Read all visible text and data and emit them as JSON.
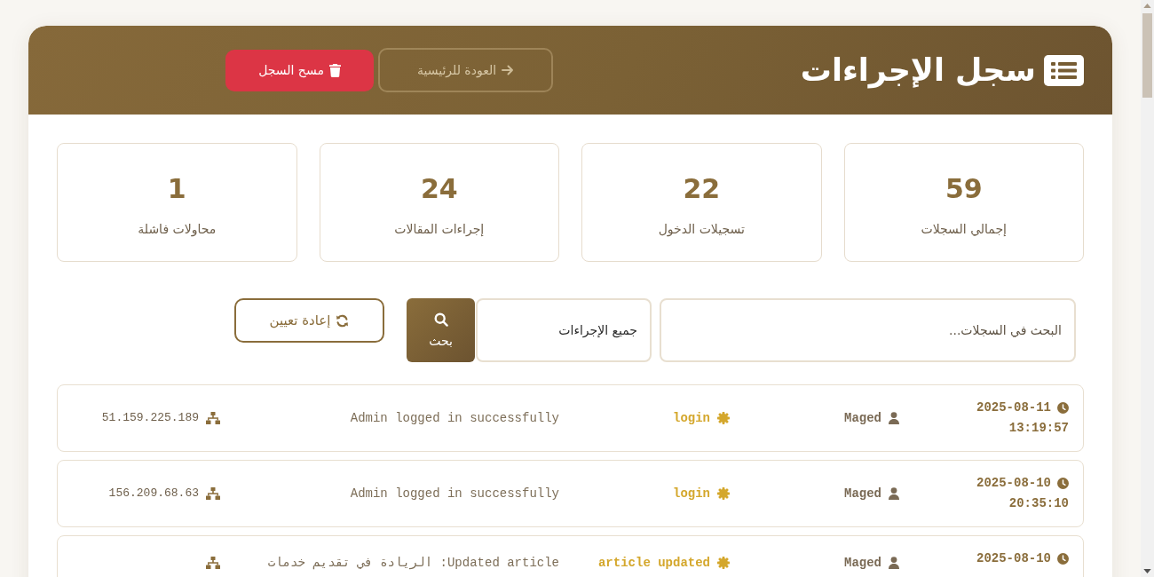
{
  "header": {
    "title": "سجل الإجراءات",
    "buttons": [
      {
        "kind": "back",
        "label": "العودة للرئيسية"
      },
      {
        "kind": "clear",
        "label": "مسح السجل"
      }
    ]
  },
  "stats": [
    {
      "value": "59",
      "label": "إجمالي السجلات"
    },
    {
      "value": "22",
      "label": "تسجيلات الدخول"
    },
    {
      "value": "24",
      "label": "إجراءات المقالات"
    },
    {
      "value": "1",
      "label": "محاولات فاشلة"
    }
  ],
  "filters": {
    "search": {
      "placeholder": "البحث في السجلات..."
    },
    "action_select": {
      "value": "جميع الإجراءات"
    },
    "search_button": {
      "label": "بحث"
    },
    "reset_button": {
      "label": "إعادة تعيين"
    }
  },
  "logs": [
    {
      "date": "2025-08-11",
      "time": "13:19:57",
      "user": "Maged",
      "action": "login",
      "description": "Admin logged in successfully",
      "ip": "51.159.225.189"
    },
    {
      "date": "2025-08-10",
      "time": "20:35:10",
      "user": "Maged",
      "action": "login",
      "description": "Admin logged in successfully",
      "ip": "156.209.68.63"
    },
    {
      "date": "2025-08-10",
      "user": "Maged",
      "action": "article updated",
      "description": "Updated article: الريادة في تقديم خدمات"
    }
  ]
}
